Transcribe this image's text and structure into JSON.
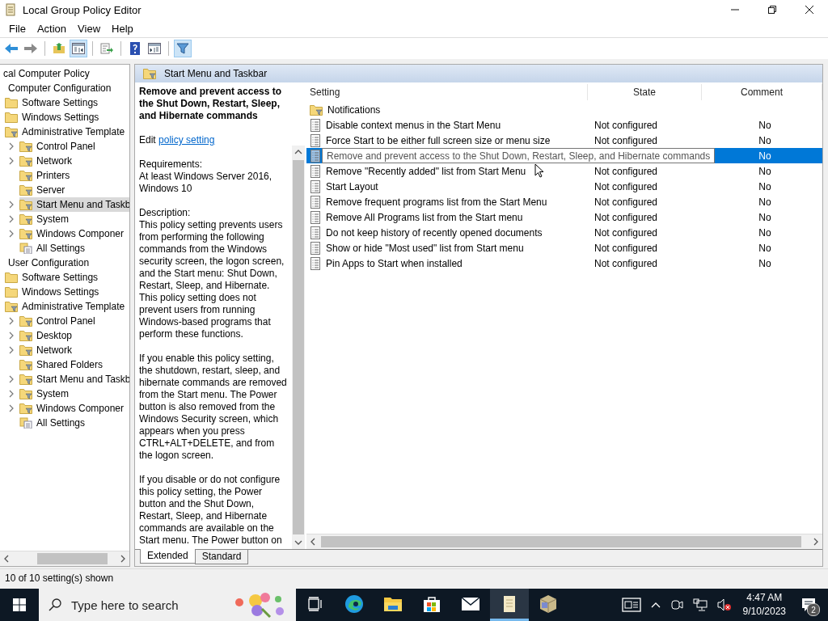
{
  "window": {
    "title": "Local Group Policy Editor"
  },
  "menu": [
    "File",
    "Action",
    "View",
    "Help"
  ],
  "toolbar": [
    {
      "kind": "back",
      "pressed": false
    },
    {
      "kind": "forward",
      "pressed": false
    },
    {
      "kind": "up",
      "pressed": false
    },
    {
      "kind": "tree",
      "pressed": true
    },
    {
      "kind": "export",
      "pressed": false
    },
    {
      "kind": "help",
      "pressed": false
    },
    {
      "kind": "pane",
      "pressed": false
    },
    {
      "kind": "filter",
      "pressed": true
    }
  ],
  "tree": [
    {
      "label": "cal Computer Policy",
      "selected": false,
      "children": [
        {
          "label": "Computer Configuration",
          "selected": false,
          "children": [
            {
              "label": "Software Settings",
              "kind": "folder",
              "selected": false
            },
            {
              "label": "Windows Settings",
              "kind": "folder",
              "selected": false
            },
            {
              "label": "Administrative Template",
              "kind": "policy-folder",
              "selected": false,
              "children": [
                {
                  "label": "Control Panel",
                  "kind": "policy-folder",
                  "expandable": true,
                  "selected": false
                },
                {
                  "label": "Network",
                  "kind": "policy-folder",
                  "expandable": true,
                  "selected": false
                },
                {
                  "label": "Printers",
                  "kind": "policy-folder",
                  "expandable": false,
                  "selected": false
                },
                {
                  "label": "Server",
                  "kind": "policy-folder",
                  "expandable": false,
                  "selected": false
                },
                {
                  "label": "Start Menu and Taskb",
                  "kind": "policy-folder",
                  "expandable": true,
                  "selected": true
                },
                {
                  "label": "System",
                  "kind": "policy-folder",
                  "expandable": true,
                  "selected": false
                },
                {
                  "label": "Windows Componer",
                  "kind": "policy-folder",
                  "expandable": true,
                  "selected": false
                },
                {
                  "label": "All Settings",
                  "kind": "settings",
                  "expandable": false,
                  "selected": false
                }
              ]
            }
          ]
        },
        {
          "label": "User Configuration",
          "selected": false,
          "children": [
            {
              "label": "Software Settings",
              "kind": "folder",
              "selected": false
            },
            {
              "label": "Windows Settings",
              "kind": "folder",
              "selected": false
            },
            {
              "label": "Administrative Template",
              "kind": "policy-folder",
              "selected": false,
              "children": [
                {
                  "label": "Control Panel",
                  "kind": "policy-folder",
                  "expandable": true,
                  "selected": false
                },
                {
                  "label": "Desktop",
                  "kind": "policy-folder",
                  "expandable": true,
                  "selected": false
                },
                {
                  "label": "Network",
                  "kind": "policy-folder",
                  "expandable": true,
                  "selected": false
                },
                {
                  "label": "Shared Folders",
                  "kind": "policy-folder",
                  "expandable": false,
                  "selected": false
                },
                {
                  "label": "Start Menu and Taskb",
                  "kind": "policy-folder",
                  "expandable": true,
                  "selected": false
                },
                {
                  "label": "System",
                  "kind": "policy-folder",
                  "expandable": true,
                  "selected": false
                },
                {
                  "label": "Windows Componer",
                  "kind": "policy-folder",
                  "expandable": true,
                  "selected": false
                },
                {
                  "label": "All Settings",
                  "kind": "settings",
                  "expandable": false,
                  "selected": false
                }
              ]
            }
          ]
        }
      ]
    }
  ],
  "header": {
    "title": "Start Menu and Taskbar"
  },
  "details": {
    "title": "Remove and prevent access to the Shut Down, Restart, Sleep, and Hibernate commands",
    "edit_prefix": "Edit",
    "link": "policy setting",
    "requirements_label": "Requirements:",
    "requirements": "At least Windows Server 2016, Windows 10",
    "description_label": "Description:",
    "paragraphs": [
      "This policy setting prevents users from performing the following commands from the Windows security screen, the logon screen, and the Start menu: Shut Down, Restart, Sleep, and Hibernate. This policy setting does not prevent users from running Windows-based programs that perform these functions.",
      "If you enable this policy setting, the shutdown, restart, sleep, and hibernate commands are removed from the Start menu. The Power button is also removed from the Windows Security screen, which appears when you press CTRL+ALT+DELETE, and from the logon screen.",
      "If you disable or do not configure this policy setting, the Power button and the Shut Down, Restart, Sleep, and Hibernate commands are available on the Start menu. The Power button on"
    ]
  },
  "table": {
    "columns": [
      "Setting",
      "State",
      "Comment"
    ],
    "rows": [
      {
        "kind": "folder",
        "setting": "Notifications",
        "selected": false
      },
      {
        "kind": "policy",
        "setting": "Disable context menus in the Start Menu",
        "state": "Not configured",
        "comment": "No",
        "selected": false,
        "tooltip": false
      },
      {
        "kind": "policy",
        "setting": "Force Start to be either full screen size or menu size",
        "state": "Not configured",
        "comment": "No",
        "selected": false,
        "tooltip": false
      },
      {
        "kind": "policy",
        "setting": "Remove and prevent access to the Shut Down, Restart, Sleep, and Hibernate commands",
        "comment": "No",
        "selected": true,
        "tooltip": true
      },
      {
        "kind": "policy",
        "setting": "Remove \"Recently added\" list from Start Menu",
        "state": "Not configured",
        "comment": "No",
        "selected": false,
        "tooltip": false
      },
      {
        "kind": "policy",
        "setting": "Start Layout",
        "state": "Not configured",
        "comment": "No",
        "selected": false,
        "tooltip": false
      },
      {
        "kind": "policy",
        "setting": "Remove frequent programs list from the Start Menu",
        "state": "Not configured",
        "comment": "No",
        "selected": false,
        "tooltip": false
      },
      {
        "kind": "policy",
        "setting": "Remove All Programs list from the Start menu",
        "state": "Not configured",
        "comment": "No",
        "selected": false,
        "tooltip": false
      },
      {
        "kind": "policy",
        "setting": "Do not keep history of recently opened documents",
        "state": "Not configured",
        "comment": "No",
        "selected": false,
        "tooltip": false
      },
      {
        "kind": "policy",
        "setting": "Show or hide \"Most used\" list from Start menu",
        "state": "Not configured",
        "comment": "No",
        "selected": false,
        "tooltip": false
      },
      {
        "kind": "policy",
        "setting": "Pin Apps to Start when installed",
        "state": "Not configured",
        "comment": "No",
        "selected": false,
        "tooltip": false
      }
    ]
  },
  "view_tabs": [
    {
      "label": "Extended",
      "selected": true
    },
    {
      "label": "Standard",
      "selected": false
    }
  ],
  "status_bar": "10 of 10 setting(s) shown",
  "taskbar": {
    "search_placeholder": "Type here to search",
    "apps": [
      {
        "kind": "task-view",
        "active": false
      },
      {
        "kind": "edge",
        "active": false
      },
      {
        "kind": "explorer",
        "active": false
      },
      {
        "kind": "store",
        "active": false
      },
      {
        "kind": "mail",
        "active": false
      },
      {
        "kind": "scroll",
        "active": true
      },
      {
        "kind": "cube",
        "active": false
      }
    ],
    "time": "4:47 AM",
    "date": "9/10/2023",
    "notifications": "2"
  }
}
